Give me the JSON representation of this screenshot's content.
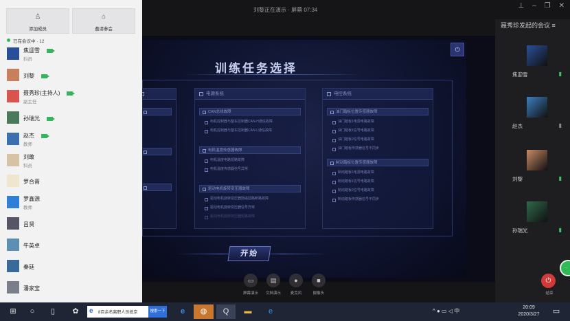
{
  "window": {
    "title": "刘黎正在演示 · 屏幕 07:34",
    "controls": [
      "⊥",
      "–",
      "❐",
      "✕"
    ]
  },
  "left_panel": {
    "buttons": [
      {
        "icon": "add-user-icon",
        "label": "添加成员"
      },
      {
        "icon": "invite-icon",
        "label": "邀请参会"
      }
    ],
    "online_label": "已在会议中 · 12",
    "members": [
      {
        "name": "焦迎雪",
        "role": "科员",
        "camera": true,
        "avatar_color": "#2a4f9a"
      },
      {
        "name": "刘黎",
        "role": "",
        "camera": true,
        "avatar_color": "#c7805d"
      },
      {
        "name": "聂秀珍(主持人)",
        "role": "副主任",
        "camera": true,
        "avatar_color": "#d9534f"
      },
      {
        "name": "孙瑞光",
        "role": "",
        "camera": true,
        "avatar_color": "#4a7a5a"
      },
      {
        "name": "赵杰",
        "role": "教师",
        "camera": true,
        "avatar_color": "#3b6fb0"
      },
      {
        "name": "刘敢",
        "role": "科员",
        "camera": false,
        "avatar_color": "#d6c3a6"
      },
      {
        "name": "罗合晋",
        "role": "",
        "camera": false,
        "avatar_color": "#efe6cf"
      },
      {
        "name": "罗鑫源",
        "role": "教师",
        "camera": false,
        "avatar_color": "#2f7fd8"
      },
      {
        "name": "吕贤",
        "role": "",
        "camera": false,
        "avatar_color": "#556"
      },
      {
        "name": "牛英卓",
        "role": "",
        "camera": false,
        "avatar_color": "#5c8fb3"
      },
      {
        "name": "秦廷",
        "role": "",
        "camera": false,
        "avatar_color": "#3a6a9a"
      },
      {
        "name": "潘家宝",
        "role": "",
        "camera": false,
        "avatar_color": "#7a7f8a"
      }
    ]
  },
  "slide": {
    "title": "训练任务选择",
    "start_label": "开始",
    "power_label": "⏻",
    "panels": [
      {
        "head": "电源系统",
        "groups": [
          {
            "name": "CAN总线故障",
            "items": [
              "电机控制器与整车控制器CAN-H通信故障",
              "电机控制器与整车控制器CAN-L通信故障"
            ]
          },
          {
            "name": "电机温度传感器故障",
            "items": [
              "电机温度电路短路故障",
              "电机温度传感器信号异常"
            ]
          },
          {
            "name": "驱动电机旋转变压器故障",
            "items": [
              "驱动电机旋转变压器励磁回路断路故障",
              "驱动电机旋转变压器信号异常",
              "驱动电机旋转变压器短路故障"
            ]
          }
        ]
      },
      {
        "head": "电控系统",
        "groups": [
          {
            "name": "油门踏板位置传感器故障",
            "items": [
              "油门踏板1电源电路故障",
              "油门踏板1信号电路故障",
              "油门踏板2信号电路故障",
              "油门踏板传感器信号不同步"
            ]
          },
          {
            "name": "制动踏板位置传感器故障",
            "items": [
              "制动踏板1电源电路故障",
              "制动踏板1信号电路故障",
              "制动踏板2信号电路故障",
              "制动踏板传感器信号不同步"
            ]
          }
        ]
      }
    ],
    "left_partial_panel": {
      "groups": 3
    }
  },
  "meeting_bar": [
    {
      "icon": "screen-share-icon",
      "label": "屏幕演示"
    },
    {
      "icon": "doc-share-icon",
      "label": "文档演示"
    },
    {
      "icon": "microphone-icon",
      "label": "麦克风"
    },
    {
      "icon": "camera-icon",
      "label": "摄像头"
    }
  ],
  "right_col": {
    "header": "聂秀珍发起的会议",
    "participants": [
      {
        "name": "焦迎雪",
        "mic_on": true,
        "color": "#2a4f9a"
      },
      {
        "name": "赵杰",
        "mic_on": false,
        "color": "#3b7fc0"
      },
      {
        "name": "刘黎",
        "mic_on": true,
        "color": "#c98a64"
      },
      {
        "name": "孙瑞光",
        "mic_on": true,
        "color": "#2e6a4a"
      }
    ],
    "end_label": "结束"
  },
  "taskbar": {
    "search_text": "8百余名离职人员抵京",
    "search_button": "搜索一下",
    "tray": "^ ● ▭ ◁ 中",
    "time": "20:09",
    "date": "2020/3/27"
  }
}
